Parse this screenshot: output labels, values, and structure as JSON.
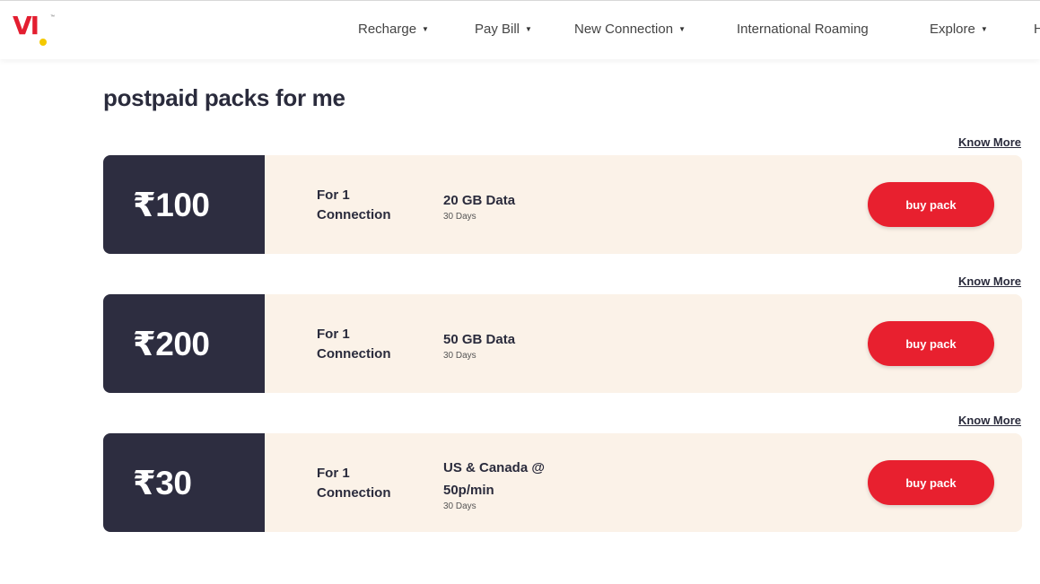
{
  "header": {
    "logo_text": "VI",
    "nav": [
      {
        "label": "Recharge",
        "has_dropdown": true
      },
      {
        "label": "Pay Bill",
        "has_dropdown": true
      },
      {
        "label": "New Connection",
        "has_dropdown": true
      },
      {
        "label": "International Roaming",
        "has_dropdown": false
      },
      {
        "label": "Explore",
        "has_dropdown": true
      },
      {
        "label": "H",
        "has_dropdown": false
      }
    ],
    "caret_glyph": "▼"
  },
  "page": {
    "title": "postpaid packs for me"
  },
  "packs": [
    {
      "price": "₹100",
      "connection": "For 1 Connection",
      "benefit": "20 GB Data",
      "validity": "30 Days",
      "know_more": "Know More",
      "buy_label": "buy pack"
    },
    {
      "price": "₹200",
      "connection": "For 1 Connection",
      "benefit": "50 GB Data",
      "validity": "30 Days",
      "know_more": "Know More",
      "buy_label": "buy pack"
    },
    {
      "price": "₹30",
      "connection": "For 1 Connection",
      "benefit": "US & Canada @ 50p/min",
      "validity": "30 Days",
      "know_more": "Know More",
      "buy_label": "buy pack"
    }
  ],
  "colors": {
    "brand_red": "#e8202f",
    "brand_yellow": "#f4c900",
    "price_bg": "#2d2d40",
    "card_bg": "#fbf2e8",
    "text_dark": "#2a2b3c"
  }
}
